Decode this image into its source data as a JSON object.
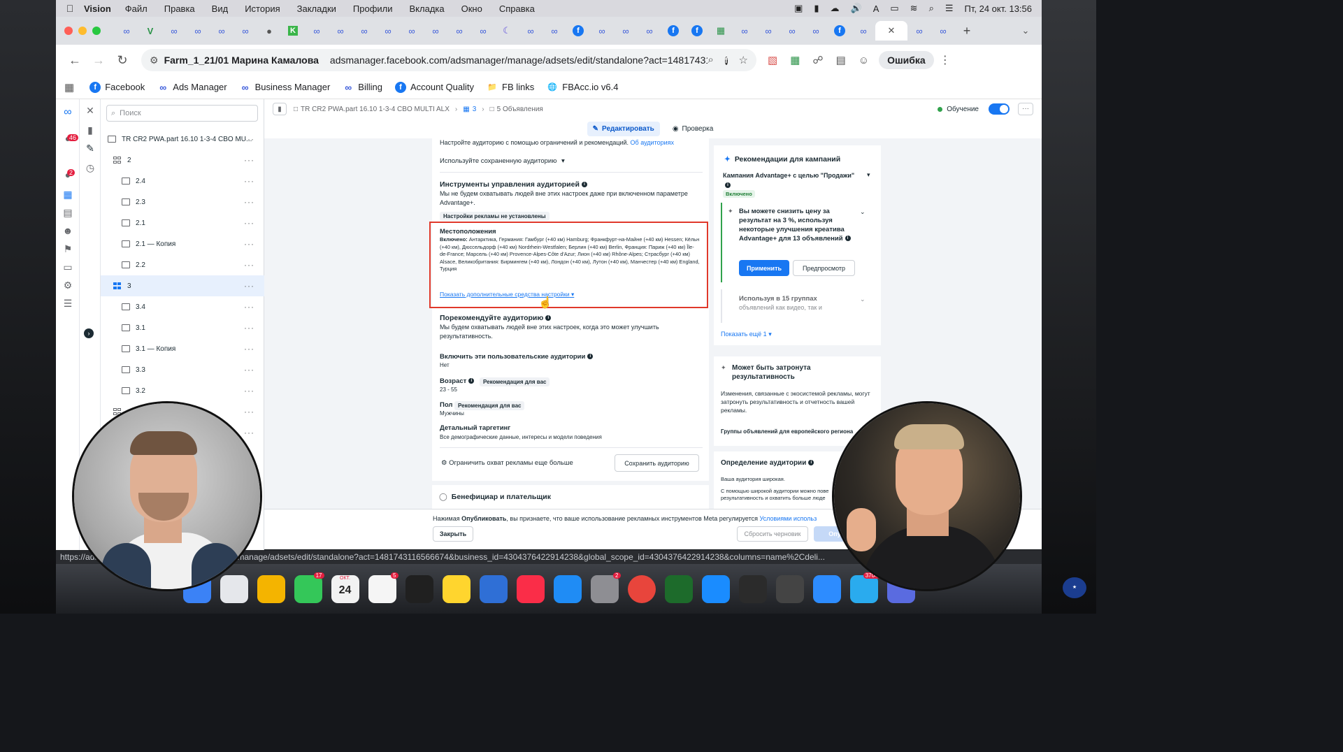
{
  "menubar": {
    "app_name": "Vision",
    "items": [
      "Файл",
      "Правка",
      "Вид",
      "История",
      "Закладки",
      "Профили",
      "Вкладка",
      "Окно",
      "Справка"
    ],
    "clock": "Пт, 24 окт. 13:56"
  },
  "browser": {
    "profile": "Farm_1_21/01 Марина Камалова",
    "url": "adsmanager.facebook.com/adsmanager/manage/adsets/edit/standalone?act=1481743116566674...",
    "error_button": "Ошибка",
    "status_url": "https://adsmanager.facebook.com/adsmanager/manage/adsets/edit/standalone?act=1481743116566674&business_id=4304376422914238&global_scope_id=4304376422914238&columns=name%2Cdeli..."
  },
  "bookmarks": [
    {
      "label": "Facebook",
      "icon": "facebook-icon"
    },
    {
      "label": "Ads Manager",
      "icon": "meta-icon"
    },
    {
      "label": "Business Manager",
      "icon": "meta-icon"
    },
    {
      "label": "Billing",
      "icon": "meta-icon"
    },
    {
      "label": "Account Quality",
      "icon": "facebook-icon"
    },
    {
      "label": "FB links",
      "icon": "folder-icon"
    },
    {
      "label": "FBAcc.io v6.4",
      "icon": "globe-icon"
    }
  ],
  "rail": {
    "badge1": "46",
    "badge2": "2"
  },
  "tree": {
    "search_placeholder": "Поиск",
    "campaign": "TR CR2 PWA.part 16.10 1-3-4 CBO MU...",
    "rows": [
      "2",
      "2.4",
      "2.3",
      "2.1",
      "2.1 — Копия",
      "2.2",
      "3",
      "3.4",
      "3.1",
      "3.1 — Копия",
      "3.3",
      "3.2"
    ]
  },
  "topbar": {
    "crumb_campaign": "TR CR2 PWA.part 16.10 1-3-4 CBO MULTI ALX",
    "crumb_adset": "3",
    "crumb_ads": "5 Объявления",
    "learning": "Обучение",
    "tab_edit": "Редактировать",
    "tab_review": "Проверка"
  },
  "form": {
    "intro": "Настройте аудиторию с помощью ограничений и рекомендаций.",
    "intro_link": "Об аудиториях",
    "saved_audience": "Используйте сохраненную аудиторию",
    "controls_title": "Инструменты управления аудиторией",
    "controls_desc": "Мы не будем охватывать людей вне этих настроек даже при включенном параметре Advantage+.",
    "controls_pill": "Настройки рекламы не установлены",
    "locations_title": "Местоположения",
    "locations_label": "Включено:",
    "locations_text": "Антарктика, Германия: Гамбург (+40 км) Hamburg; Франкфурт-на-Майне (+40 км) Hessen; Кёльн (+40 км), Дюссельдорф (+40 км) Nordrhein-Westfalen; Берлин (+40 км) Berlin, Франция: Париж (+40 км) Île-de-France; Марсель (+40 км) Provence-Alpes-Côte d'Azur; Лион (+40 км) Rhône-Alpes; Страсбург (+40 км) Alsace, Великобритания: Бирмингем (+40 км), Лондон (+40 км), Лутон (+40 км), Манчестер (+40 км) England, Турция",
    "show_more": "Показать дополнительные средства настройки",
    "suggest_title": "Порекомендуйте аудиторию",
    "suggest_desc": "Мы будем охватывать людей вне этих настроек, когда это может улучшить результативность.",
    "custom_title": "Включить эти пользовательские аудитории",
    "custom_value": "Нет",
    "age_title": "Возраст",
    "age_pill": "Рекомендация для вас",
    "age_value": "23 - 55",
    "gender_title": "Пол",
    "gender_pill": "Рекомендация для вас",
    "gender_value": "Мужчины",
    "detailed_title": "Детальный таргетинг",
    "detailed_value": "Все демографические данные, интересы и модели поведения",
    "limit_reach": "Ограничить охват рекламы еще больше",
    "save_audience": "Сохранить аудиторию",
    "beneficiary": "Бенефициар и плательщик"
  },
  "right": {
    "reco_title": "Рекомендации для кампаний",
    "campaign_line": "Кампания Advantage+ с целью \"Продажи\"",
    "enabled_badge": "Включено",
    "tip_text": "Вы можете снизить цену за результат на 3 %, используя некоторые улучшения креатива Advantage+ для 13 объявлений",
    "apply": "Применить",
    "preview": "Предпросмотр",
    "tip2_line1": "Используя в 15 группах",
    "tip2_line2": "объявлений как видео, так и",
    "show_more": "Показать ещё 1",
    "impact_title": "Может быть затронута результативность",
    "impact_text": "Изменения, связанные с экосистемой рекламы, могут затронуть результативность и отчетность вашей рекламы.",
    "impact_link": "Группы объявлений для европейского региона",
    "def_title": "Определение аудитории",
    "def_value": "Ваша аудитория широкая.",
    "def_text1": "С помощью широкой аудитории можно пове",
    "def_text2": "результативность и охватить больше люде"
  },
  "bottom": {
    "notice_prefix": "Нажимая",
    "notice_bold": "Опубликовать",
    "notice_rest": ", вы признаете, что ваше использование рекламных инструментов Meta регулируется",
    "notice_link": "Условиями использ",
    "close": "Закрыть",
    "reset": "Сбросить черновик",
    "publish": "Опу"
  },
  "dock": {
    "date_badge": "24",
    "date_month": "ОКТ.",
    "badges": [
      "17",
      "5",
      "2",
      "3704"
    ]
  },
  "colors": {
    "accent": "#1877f2",
    "highlight_box": "#e0392b",
    "success": "#31a24c"
  }
}
